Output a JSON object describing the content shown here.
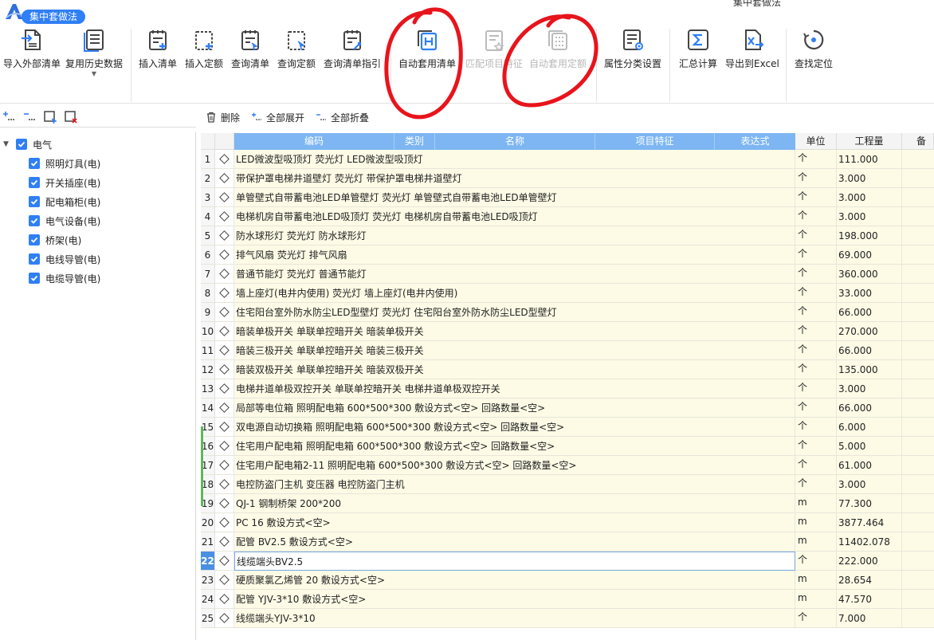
{
  "window": {
    "title": "集中套做法",
    "tab_label": "集中套做法"
  },
  "toolbar": {
    "buttons": [
      {
        "label": "导入外部清单",
        "icon": "import-list-icon",
        "enabled": true
      },
      {
        "label": "复用历史数据",
        "icon": "reuse-history-icon",
        "enabled": true,
        "has_dropdown": true
      },
      {
        "label": "插入清单",
        "icon": "insert-list-icon",
        "enabled": true
      },
      {
        "label": "插入定额",
        "icon": "insert-quota-icon",
        "enabled": true
      },
      {
        "label": "查询清单",
        "icon": "query-list-icon",
        "enabled": true
      },
      {
        "label": "查询定额",
        "icon": "query-quota-icon",
        "enabled": true
      },
      {
        "label": "查询清单指引",
        "icon": "query-guide-icon",
        "enabled": true
      },
      {
        "label": "自动套用清单",
        "icon": "auto-apply-list-icon",
        "enabled": true
      },
      {
        "label": "匹配项目特征",
        "icon": "match-feature-icon",
        "enabled": false
      },
      {
        "label": "自动套用定额",
        "icon": "auto-apply-quota-icon",
        "enabled": false
      },
      {
        "label": "属性分类设置",
        "icon": "attribute-category-icon",
        "enabled": true
      },
      {
        "label": "汇总计算",
        "icon": "sum-calc-icon",
        "enabled": true
      },
      {
        "label": "导出到Excel",
        "icon": "export-excel-icon",
        "enabled": true
      },
      {
        "label": "查找定位",
        "icon": "find-locate-icon",
        "enabled": true
      }
    ]
  },
  "tree": {
    "root": {
      "label": "电气",
      "checked": true,
      "expanded": true
    },
    "children": [
      {
        "label": "照明灯具(电)",
        "checked": true
      },
      {
        "label": "开关插座(电)",
        "checked": true
      },
      {
        "label": "配电箱柜(电)",
        "checked": true
      },
      {
        "label": "电气设备(电)",
        "checked": true
      },
      {
        "label": "桥架(电)",
        "checked": true
      },
      {
        "label": "电线导管(电)",
        "checked": true
      },
      {
        "label": "电缆导管(电)",
        "checked": true
      }
    ]
  },
  "grid_toolbar": {
    "delete": "删除",
    "expand_all": "全部展开",
    "collapse_all": "全部折叠"
  },
  "grid": {
    "headers": {
      "code": "编码",
      "category": "类别",
      "name": "名称",
      "feature": "项目特征",
      "expression": "表达式",
      "unit": "单位",
      "quantity": "工程量",
      "note": "备注"
    },
    "rows": [
      {
        "no": "1",
        "name": "LED微波型吸顶灯 荧光灯 LED微波型吸顶灯",
        "unit": "个",
        "qty": "111.000"
      },
      {
        "no": "2",
        "name": "带保护罩电梯井道壁灯 荧光灯 带保护罩电梯井道壁灯",
        "unit": "个",
        "qty": "3.000"
      },
      {
        "no": "3",
        "name": "单管壁式自带蓄电池LED单管壁灯 荧光灯 单管壁式自带蓄电池LED单管壁灯",
        "unit": "个",
        "qty": "3.000"
      },
      {
        "no": "4",
        "name": "电梯机房自带蓄电池LED吸顶灯 荧光灯 电梯机房自带蓄电池LED吸顶灯",
        "unit": "个",
        "qty": "3.000"
      },
      {
        "no": "5",
        "name": "防水球形灯 荧光灯 防水球形灯",
        "unit": "个",
        "qty": "198.000"
      },
      {
        "no": "6",
        "name": "排气风扇 荧光灯 排气风扇",
        "unit": "个",
        "qty": "69.000"
      },
      {
        "no": "7",
        "name": "普通节能灯 荧光灯 普通节能灯",
        "unit": "个",
        "qty": "360.000"
      },
      {
        "no": "8",
        "name": "墙上座灯(电井内使用) 荧光灯 墙上座灯(电井内使用)",
        "unit": "个",
        "qty": "33.000"
      },
      {
        "no": "9",
        "name": "住宅阳台室外防水防尘LED型壁灯 荧光灯 住宅阳台室外防水防尘LED型壁灯",
        "unit": "个",
        "qty": "66.000"
      },
      {
        "no": "10",
        "name": "暗装单极开关 单联单控暗开关 暗装单极开关",
        "unit": "个",
        "qty": "270.000"
      },
      {
        "no": "11",
        "name": "暗装三极开关 单联单控暗开关 暗装三极开关",
        "unit": "个",
        "qty": "66.000"
      },
      {
        "no": "12",
        "name": "暗装双极开关 单联单控暗开关 暗装双极开关",
        "unit": "个",
        "qty": "135.000"
      },
      {
        "no": "13",
        "name": "电梯井道单极双控开关 单联单控暗开关 电梯井道单极双控开关",
        "unit": "个",
        "qty": "3.000"
      },
      {
        "no": "14",
        "name": "局部等电位箱 照明配电箱 600*500*300 敷设方式<空> 回路数量<空>",
        "unit": "个",
        "qty": "66.000"
      },
      {
        "no": "15",
        "name": "双电源自动切换箱 照明配电箱 600*500*300 敷设方式<空> 回路数量<空>",
        "unit": "个",
        "qty": "6.000"
      },
      {
        "no": "16",
        "name": "住宅用户配电箱 照明配电箱 600*500*300 敷设方式<空> 回路数量<空>",
        "unit": "个",
        "qty": "5.000"
      },
      {
        "no": "17",
        "name": "住宅用户配电箱2-11 照明配电箱 600*500*300 敷设方式<空> 回路数量<空>",
        "unit": "个",
        "qty": "61.000"
      },
      {
        "no": "18",
        "name": "电控防盗门主机 变压器 电控防盗门主机",
        "unit": "个",
        "qty": "3.000"
      },
      {
        "no": "19",
        "name": "QJ-1 钢制桥架 200*200",
        "unit": "m",
        "qty": "77.300"
      },
      {
        "no": "20",
        "name": "PC 16 敷设方式<空>",
        "unit": "m",
        "qty": "3877.464"
      },
      {
        "no": "21",
        "name": "配管 BV2.5 敷设方式<空>",
        "unit": "m",
        "qty": "11402.078"
      },
      {
        "no": "22",
        "name": "线缆端头BV2.5",
        "unit": "个",
        "qty": "222.000",
        "selected": true
      },
      {
        "no": "23",
        "name": "硬质聚氯乙烯管 20 敷设方式<空>",
        "unit": "m",
        "qty": "28.654"
      },
      {
        "no": "24",
        "name": "配管 YJV-3*10 敷设方式<空>",
        "unit": "m",
        "qty": "47.570"
      },
      {
        "no": "25",
        "name": "线缆端头YJV-3*10",
        "unit": "个",
        "qty": "7.000"
      }
    ]
  },
  "colors": {
    "accent": "#2f7ff5",
    "header_blue": "#7db6f2",
    "row_bg": "#fdfbe6",
    "annotation_red": "#e8141c"
  }
}
